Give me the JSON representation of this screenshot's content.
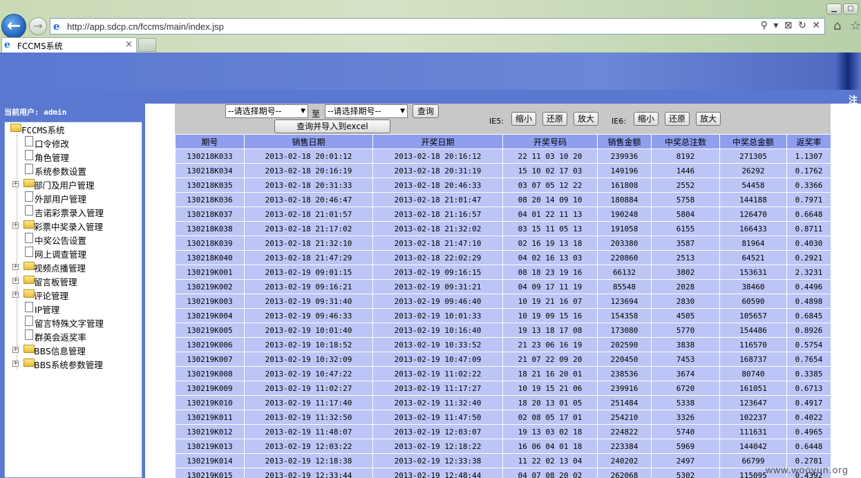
{
  "browser": {
    "url": "http://app.sdcp.cn/fccms/main/index.jsp",
    "tab_title": "FCCMS系统",
    "addr_tools": "⚲ ▾ ⊠ ↻ ✕"
  },
  "header": {
    "logout_text": "注"
  },
  "sidebar": {
    "current_user": "当前用户: admin",
    "tree": [
      {
        "label": "FCCMS系统",
        "kind": "root"
      },
      {
        "label": "口令修改",
        "kind": "doc"
      },
      {
        "label": "角色管理",
        "kind": "doc"
      },
      {
        "label": "系统参数设置",
        "kind": "doc"
      },
      {
        "label": "部门及用户管理",
        "kind": "folder"
      },
      {
        "label": "外部用户管理",
        "kind": "doc"
      },
      {
        "label": "吉诺彩票录入管理",
        "kind": "doc"
      },
      {
        "label": "彩票中奖录入管理",
        "kind": "folder"
      },
      {
        "label": "中奖公告设置",
        "kind": "doc"
      },
      {
        "label": "网上调查管理",
        "kind": "doc"
      },
      {
        "label": "视频点播管理",
        "kind": "folder"
      },
      {
        "label": "留言板管理",
        "kind": "folder"
      },
      {
        "label": "评论管理",
        "kind": "folder"
      },
      {
        "label": "IP管理",
        "kind": "doc"
      },
      {
        "label": "留言特殊文字管理",
        "kind": "doc"
      },
      {
        "label": "群英会返奖率",
        "kind": "doc"
      },
      {
        "label": "BBS信息管理",
        "kind": "folder"
      },
      {
        "label": "BBS系统参数管理",
        "kind": "folder"
      }
    ]
  },
  "toolbar": {
    "select_start": "--请选择期号--",
    "to_label": "至",
    "select_end": "--请选择期号--",
    "query_button": "查询",
    "export_button": "查询并导入到excel",
    "ie5_label": "IE5:",
    "ie6_label": "IE6:",
    "zoom_out": "缩小",
    "restore": "还原",
    "zoom_in": "放大"
  },
  "table": {
    "columns": [
      "期号",
      "销售日期",
      "开奖日期",
      "开奖号码",
      "销售金额",
      "中奖总注数",
      "中奖总金额",
      "返奖率"
    ],
    "rows": [
      [
        "130218K033",
        "2013-02-18 20:01:12",
        "2013-02-18 20:16:12",
        "22 11 03 10 20",
        "239936",
        "8192",
        "271305",
        "1.1307"
      ],
      [
        "130218K034",
        "2013-02-18 20:16:19",
        "2013-02-18 20:31:19",
        "15 10 02 17 03",
        "149196",
        "1446",
        "26292",
        "0.1762"
      ],
      [
        "130218K035",
        "2013-02-18 20:31:33",
        "2013-02-18 20:46:33",
        "03 07 05 12 22",
        "161808",
        "2552",
        "54458",
        "0.3366"
      ],
      [
        "130218K036",
        "2013-02-18 20:46:47",
        "2013-02-18 21:01:47",
        "08 20 14 09 10",
        "180884",
        "5758",
        "144188",
        "0.7971"
      ],
      [
        "130218K037",
        "2013-02-18 21:01:57",
        "2013-02-18 21:16:57",
        "04 01 22 11 13",
        "190248",
        "5804",
        "126470",
        "0.6648"
      ],
      [
        "130218K038",
        "2013-02-18 21:17:02",
        "2013-02-18 21:32:02",
        "03 15 11 05 13",
        "191058",
        "6155",
        "166433",
        "0.8711"
      ],
      [
        "130218K039",
        "2013-02-18 21:32:10",
        "2013-02-18 21:47:10",
        "02 16 19 13 18",
        "203380",
        "3587",
        "81964",
        "0.4030"
      ],
      [
        "130218K040",
        "2013-02-18 21:47:29",
        "2013-02-18 22:02:29",
        "04 02 16 13 03",
        "220860",
        "2513",
        "64521",
        "0.2921"
      ],
      [
        "130219K001",
        "2013-02-19 09:01:15",
        "2013-02-19 09:16:15",
        "08 18 23 19 16",
        "66132",
        "3802",
        "153631",
        "2.3231"
      ],
      [
        "130219K002",
        "2013-02-19 09:16:21",
        "2013-02-19 09:31:21",
        "04 09 17 11 19",
        "85548",
        "2028",
        "38460",
        "0.4496"
      ],
      [
        "130219K003",
        "2013-02-19 09:31:40",
        "2013-02-19 09:46:40",
        "10 19 21 16 07",
        "123694",
        "2830",
        "60590",
        "0.4898"
      ],
      [
        "130219K004",
        "2013-02-19 09:46:33",
        "2013-02-19 10:01:33",
        "10 19 09 15 16",
        "154358",
        "4505",
        "105657",
        "0.6845"
      ],
      [
        "130219K005",
        "2013-02-19 10:01:40",
        "2013-02-19 10:16:40",
        "19 13 18 17 08",
        "173080",
        "5770",
        "154486",
        "0.8926"
      ],
      [
        "130219K006",
        "2013-02-19 10:18:52",
        "2013-02-19 10:33:52",
        "21 23 06 16 19",
        "202590",
        "3838",
        "116570",
        "0.5754"
      ],
      [
        "130219K007",
        "2013-02-19 10:32:09",
        "2013-02-19 10:47:09",
        "21 07 22 09 20",
        "220450",
        "7453",
        "168737",
        "0.7654"
      ],
      [
        "130219K008",
        "2013-02-19 10:47:22",
        "2013-02-19 11:02:22",
        "18 21 16 20 01",
        "238536",
        "3674",
        "80740",
        "0.3385"
      ],
      [
        "130219K009",
        "2013-02-19 11:02:27",
        "2013-02-19 11:17:27",
        "10 19 15 21 06",
        "239916",
        "6720",
        "161051",
        "0.6713"
      ],
      [
        "130219K010",
        "2013-02-19 11:17:40",
        "2013-02-19 11:32:40",
        "18 20 13 01 05",
        "251484",
        "5338",
        "123647",
        "0.4917"
      ],
      [
        "130219K011",
        "2013-02-19 11:32:50",
        "2013-02-19 11:47:50",
        "02 08 05 17 01",
        "254210",
        "3326",
        "102237",
        "0.4022"
      ],
      [
        "130219K012",
        "2013-02-19 11:48:07",
        "2013-02-19 12:03:07",
        "19 13 03 02 18",
        "224822",
        "5740",
        "111631",
        "0.4965"
      ],
      [
        "130219K013",
        "2013-02-19 12:03:22",
        "2013-02-19 12:18:22",
        "16 06 04 01 18",
        "223384",
        "5969",
        "144042",
        "0.6448"
      ],
      [
        "130219K014",
        "2013-02-19 12:18:38",
        "2013-02-19 12:33:38",
        "11 22 02 13 04",
        "240202",
        "2497",
        "66799",
        "0.2781"
      ],
      [
        "130219K015",
        "2013-02-19 12:33:44",
        "2013-02-19 12:48:44",
        "04 07 08 20 02",
        "262068",
        "5302",
        "115095",
        "0.4392"
      ]
    ]
  },
  "watermark": "www.wooyun.org"
}
